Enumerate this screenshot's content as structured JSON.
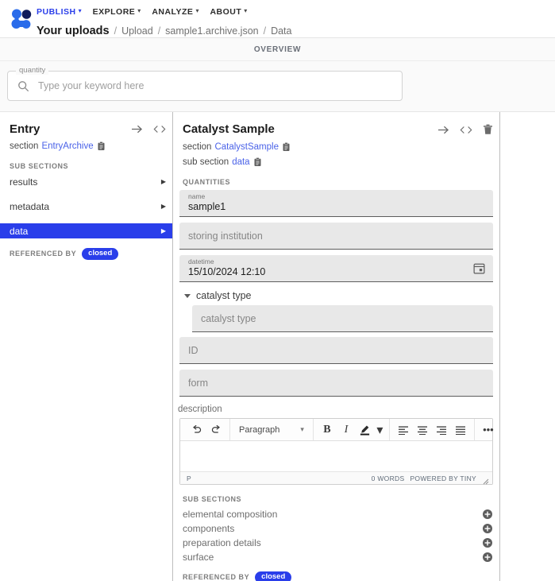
{
  "header": {
    "logo_icon": "nomad-logo-icon",
    "nav": [
      {
        "label": "PUBLISH",
        "active": true,
        "caret": "chevron-down-icon"
      },
      {
        "label": "EXPLORE",
        "active": false,
        "caret": "chevron-down-icon"
      },
      {
        "label": "ANALYZE",
        "active": false,
        "caret": "chevron-down-icon"
      },
      {
        "label": "ABOUT",
        "active": false,
        "caret": "chevron-down-icon"
      }
    ],
    "breadcrumb": {
      "root": "Your uploads",
      "separator": "/",
      "items": [
        "Upload",
        "sample1.archive.json",
        "Data"
      ]
    }
  },
  "tabs": {
    "overview_label": "OVERVIEW"
  },
  "search": {
    "float_label": "quantity",
    "placeholder": "Type your keyword here",
    "value": "",
    "icon": "search-icon"
  },
  "left_panel": {
    "title": "Entry",
    "icons": [
      "arrow-right-icon",
      "code-brackets-icon"
    ],
    "section_label": "section",
    "section_value": "EntryArchive",
    "section_copy_icon": "clipboard-icon",
    "sub_sections_label": "SUB SECTIONS",
    "sub_sections": [
      {
        "label": "results",
        "selected": false
      },
      {
        "label": "metadata",
        "selected": false
      },
      {
        "label": "data",
        "selected": true
      }
    ],
    "referenced_by_label": "REFERENCED BY",
    "referenced_by_chip": "closed"
  },
  "main_panel": {
    "title": "Catalyst Sample",
    "icons": [
      "arrow-right-icon",
      "code-brackets-icon",
      "trash-icon"
    ],
    "section_label": "section",
    "section_value": "CatalystSample",
    "section_copy_icon": "clipboard-icon",
    "sub_section_label": "sub section",
    "sub_section_value": "data",
    "sub_section_copy_icon": "clipboard-icon",
    "quantities_label": "QUANTITIES",
    "fields": [
      {
        "name": "name",
        "label": "name",
        "value": "sample1",
        "placeholder": "",
        "filled": true
      },
      {
        "name": "storing-institution",
        "label": "",
        "value": "",
        "placeholder": "storing institution",
        "filled": false
      },
      {
        "name": "datetime",
        "label": "datetime",
        "value": "15/10/2024 12:10",
        "placeholder": "",
        "filled": true,
        "trailing_icon": "calendar-icon"
      }
    ],
    "catalyst_type_group": {
      "title": "catalyst type",
      "expanded": true,
      "toggle_icon": "triangle-down-icon",
      "field_placeholder": "catalyst type"
    },
    "fields_after": [
      {
        "name": "id",
        "label": "",
        "value": "",
        "placeholder": "ID",
        "filled": false
      },
      {
        "name": "form",
        "label": "",
        "value": "",
        "placeholder": "form",
        "filled": false
      }
    ],
    "description": {
      "label": "description",
      "toolbar": {
        "undo": "undo-icon",
        "redo": "redo-icon",
        "block_format": "Paragraph",
        "block_caret": "chevron-down-icon",
        "bold": "B",
        "italic": "I",
        "text_color": "text-color-icon",
        "color_caret": "chevron-down-icon",
        "align_left": "align-left-icon",
        "align_center": "align-center-icon",
        "align_right": "align-right-icon",
        "align_justify": "align-justify-icon",
        "more": "•••"
      },
      "content": "",
      "status_path": "P",
      "word_count": "0 WORDS",
      "branding": "POWERED BY TINY",
      "resize_handle": "resize-grip-icon"
    },
    "sub_sections_label": "SUB SECTIONS",
    "sub_sections": [
      {
        "label": "elemental composition",
        "add_icon": "plus-circle-icon"
      },
      {
        "label": "components",
        "add_icon": "plus-circle-icon"
      },
      {
        "label": "preparation details",
        "add_icon": "plus-circle-icon"
      },
      {
        "label": "surface",
        "add_icon": "plus-circle-icon"
      }
    ],
    "referenced_by_label": "REFERENCED BY",
    "referenced_by_chip": "closed"
  },
  "colors": {
    "accent": "#2a3eea",
    "link": "#4a62e8",
    "field_bg": "#e8e8e8",
    "panel_bg": "#ffffff",
    "strip_bg": "#fafafa"
  }
}
